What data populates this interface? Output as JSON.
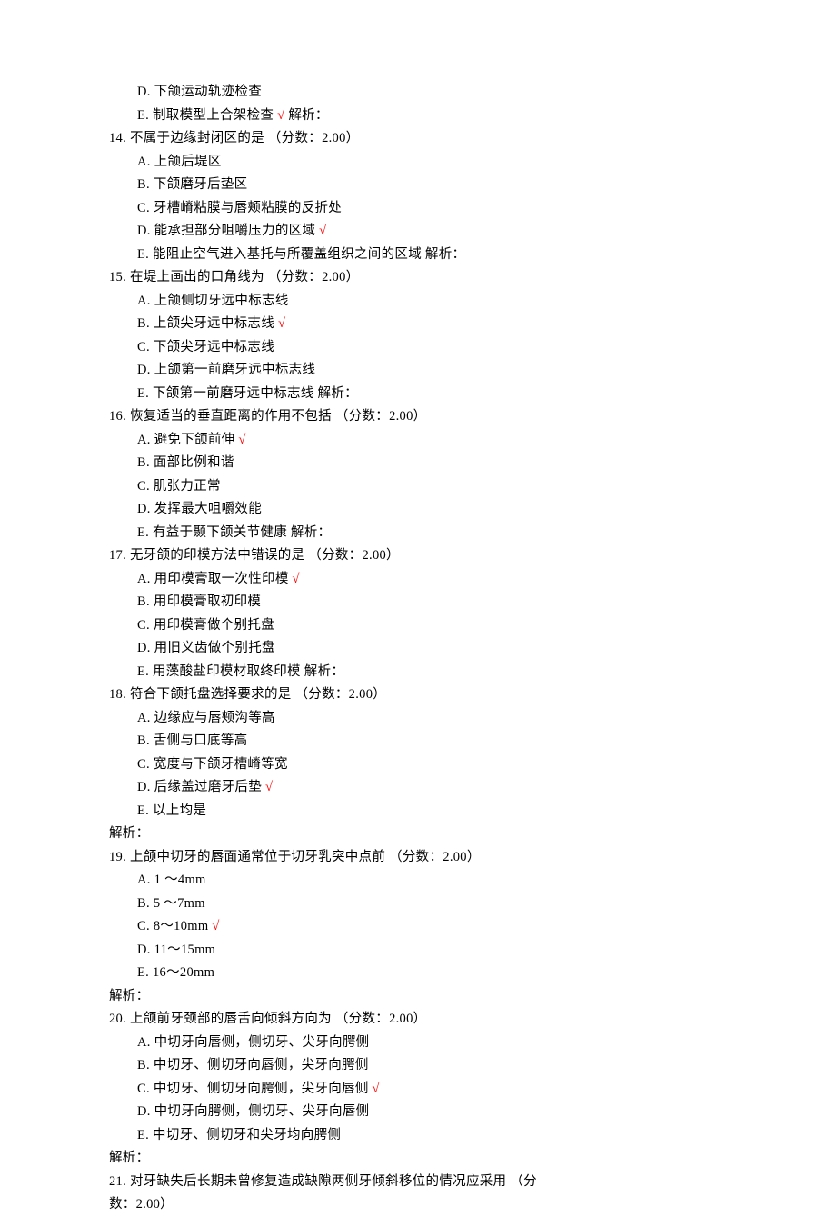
{
  "lines": [
    {
      "indent": "opt",
      "parts": [
        {
          "t": "D. 下颌运动轨迹检查"
        }
      ]
    },
    {
      "indent": "opt",
      "parts": [
        {
          "t": "E. 制取模型上合架检查 "
        },
        {
          "t": "√",
          "c": true
        },
        {
          "t": " 解析："
        }
      ]
    },
    {
      "indent": "none",
      "parts": [
        {
          "t": "14. 不属于边缘封闭区的是  （分数：2.00）"
        }
      ]
    },
    {
      "indent": "opt",
      "parts": [
        {
          "t": "A. 上颌后堤区"
        }
      ]
    },
    {
      "indent": "opt",
      "parts": [
        {
          "t": "B. 下颌磨牙后垫区"
        }
      ]
    },
    {
      "indent": "opt",
      "parts": [
        {
          "t": "C. 牙槽嵴粘膜与唇颊粘膜的反折处"
        }
      ]
    },
    {
      "indent": "opt",
      "parts": [
        {
          "t": "D. 能承担部分咀嚼压力的区域 "
        },
        {
          "t": "√",
          "c": true
        }
      ]
    },
    {
      "indent": "opt",
      "parts": [
        {
          "t": "E. 能阻止空气进入基托与所覆盖组织之间的区域 解析："
        }
      ]
    },
    {
      "indent": "none",
      "parts": [
        {
          "t": "15. 在堤上画出的口角线为  （分数：2.00）"
        }
      ]
    },
    {
      "indent": "opt",
      "parts": [
        {
          "t": "A. 上颌侧切牙远中标志线"
        }
      ]
    },
    {
      "indent": "opt",
      "parts": [
        {
          "t": "B. 上颌尖牙远中标志线 "
        },
        {
          "t": "√",
          "c": true
        }
      ]
    },
    {
      "indent": "opt",
      "parts": [
        {
          "t": "C. 下颌尖牙远中标志线"
        }
      ]
    },
    {
      "indent": "opt",
      "parts": [
        {
          "t": "D. 上颌第一前磨牙远中标志线"
        }
      ]
    },
    {
      "indent": "opt",
      "parts": [
        {
          "t": "E. 下颌第一前磨牙远中标志线 解析："
        }
      ]
    },
    {
      "indent": "none",
      "parts": [
        {
          "t": "16. 恢复适当的垂直距离的作用不包括  （分数：2.00）"
        }
      ]
    },
    {
      "indent": "opt",
      "parts": [
        {
          "t": "A. 避免下颌前伸 "
        },
        {
          "t": "√",
          "c": true
        }
      ]
    },
    {
      "indent": "opt",
      "parts": [
        {
          "t": "B. 面部比例和谐"
        }
      ]
    },
    {
      "indent": "opt",
      "parts": [
        {
          "t": "C. 肌张力正常"
        }
      ]
    },
    {
      "indent": "opt",
      "parts": [
        {
          "t": "D. 发挥最大咀嚼效能"
        }
      ]
    },
    {
      "indent": "opt",
      "parts": [
        {
          "t": "E. 有益于颞下颌关节健康 解析："
        }
      ]
    },
    {
      "indent": "none",
      "parts": [
        {
          "t": "17. 无牙颌的印模方法中错误的是  （分数：2.00）"
        }
      ]
    },
    {
      "indent": "opt",
      "parts": [
        {
          "t": "A. 用印模膏取一次性印模 "
        },
        {
          "t": "√",
          "c": true
        }
      ]
    },
    {
      "indent": "opt",
      "parts": [
        {
          "t": "B. 用印模膏取初印模"
        }
      ]
    },
    {
      "indent": "opt",
      "parts": [
        {
          "t": "C. 用印模膏做个别托盘"
        }
      ]
    },
    {
      "indent": "opt",
      "parts": [
        {
          "t": "D. 用旧义齿做个别托盘"
        }
      ]
    },
    {
      "indent": "opt",
      "parts": [
        {
          "t": "E. 用藻酸盐印模材取终印模 解析："
        }
      ]
    },
    {
      "indent": "none",
      "parts": [
        {
          "t": "18. 符合下颌托盘选择要求的是  （分数：2.00）"
        }
      ]
    },
    {
      "indent": "opt",
      "parts": [
        {
          "t": "A. 边缘应与唇颊沟等高"
        }
      ]
    },
    {
      "indent": "opt",
      "parts": [
        {
          "t": "B. 舌侧与口底等高"
        }
      ]
    },
    {
      "indent": "opt",
      "parts": [
        {
          "t": "C. 宽度与下颌牙槽嵴等宽"
        }
      ]
    },
    {
      "indent": "opt",
      "parts": [
        {
          "t": "D. 后缘盖过磨牙后垫 "
        },
        {
          "t": "√",
          "c": true
        }
      ]
    },
    {
      "indent": "opt",
      "parts": [
        {
          "t": "E. 以上均是"
        }
      ]
    },
    {
      "indent": "none",
      "parts": [
        {
          "t": "解析："
        }
      ]
    },
    {
      "indent": "none",
      "parts": [
        {
          "t": "19. 上颌中切牙的唇面通常位于切牙乳突中点前  （分数：2.00）"
        }
      ]
    },
    {
      "indent": "opt",
      "parts": [
        {
          "t": "A. 1 ～4mm"
        }
      ]
    },
    {
      "indent": "opt",
      "parts": [
        {
          "t": "B. 5 ～7mm"
        }
      ]
    },
    {
      "indent": "opt",
      "parts": [
        {
          "t": "C. 8～10mm  "
        },
        {
          "t": "√",
          "c": true
        }
      ]
    },
    {
      "indent": "opt",
      "parts": [
        {
          "t": "D. 11～15mm"
        }
      ]
    },
    {
      "indent": "opt",
      "parts": [
        {
          "t": "E. 16～20mm"
        }
      ]
    },
    {
      "indent": "none",
      "parts": [
        {
          "t": "解析："
        }
      ]
    },
    {
      "indent": "none",
      "parts": [
        {
          "t": "20. 上颌前牙颈部的唇舌向倾斜方向为  （分数：2.00）"
        }
      ]
    },
    {
      "indent": "opt",
      "parts": [
        {
          "t": "A. 中切牙向唇侧，侧切牙、尖牙向腭侧"
        }
      ]
    },
    {
      "indent": "opt",
      "parts": [
        {
          "t": "B. 中切牙、侧切牙向唇侧，尖牙向腭侧"
        }
      ]
    },
    {
      "indent": "opt",
      "parts": [
        {
          "t": "C. 中切牙、侧切牙向腭侧，尖牙向唇侧 "
        },
        {
          "t": "√",
          "c": true
        }
      ]
    },
    {
      "indent": "opt",
      "parts": [
        {
          "t": "D. 中切牙向腭侧，侧切牙、尖牙向唇侧"
        }
      ]
    },
    {
      "indent": "opt",
      "parts": [
        {
          "t": "E. 中切牙、侧切牙和尖牙均向腭侧"
        }
      ]
    },
    {
      "indent": "none",
      "parts": [
        {
          "t": "解析："
        }
      ]
    },
    {
      "indent": "none",
      "parts": [
        {
          "t": "21. 对牙缺失后长期未曾修复造成缺隙两侧牙倾斜移位的情况应采用  （分"
        }
      ]
    },
    {
      "indent": "none",
      "parts": [
        {
          "t": "数：2.00）"
        }
      ]
    }
  ]
}
